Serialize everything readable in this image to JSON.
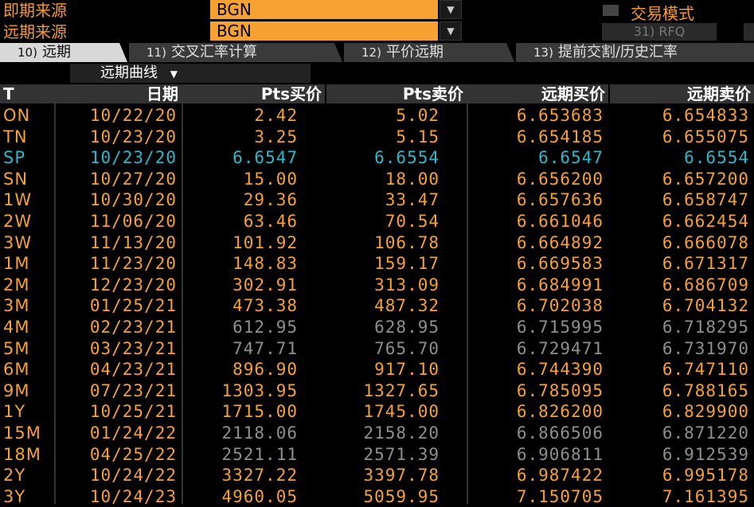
{
  "header": {
    "spot_source_label": "即期来源",
    "spot_source_value": "BGN",
    "fwd_source_label": "远期来源",
    "fwd_source_value": "BGN",
    "mode_label": "交易模式",
    "rfq_label": "31) RFQ"
  },
  "tabs": [
    {
      "num": "10)",
      "label": "远期"
    },
    {
      "num": "11)",
      "label": "交叉汇率计算"
    },
    {
      "num": "12)",
      "label": "平价远期"
    },
    {
      "num": "13)",
      "label": "提前交割/历史汇率"
    }
  ],
  "curve_select": "远期曲线",
  "columns": [
    "T",
    "日期",
    "Pts买价",
    "Pts卖价",
    "远期买价",
    "远期卖价"
  ],
  "colors": {
    "orange": "#f7a133",
    "cyan": "#2fb7c9",
    "gray": "#8f8f8f"
  },
  "rows": [
    {
      "t": "ON",
      "date": "10/22/20",
      "pb": "2.42",
      "ps": "5.02",
      "fb": "6.653683",
      "fs": "6.654833",
      "c": "orange"
    },
    {
      "t": "TN",
      "date": "10/23/20",
      "pb": "3.25",
      "ps": "5.15",
      "fb": "6.654185",
      "fs": "6.655075",
      "c": "orange"
    },
    {
      "t": "SP",
      "date": "10/23/20",
      "pb": "6.6547",
      "ps": "6.6554",
      "fb": "6.6547",
      "fs": "6.6554",
      "c": "cyan"
    },
    {
      "t": "SN",
      "date": "10/27/20",
      "pb": "15.00",
      "ps": "18.00",
      "fb": "6.656200",
      "fs": "6.657200",
      "c": "orange"
    },
    {
      "t": "1W",
      "date": "10/30/20",
      "pb": "29.36",
      "ps": "33.47",
      "fb": "6.657636",
      "fs": "6.658747",
      "c": "orange"
    },
    {
      "t": "2W",
      "date": "11/06/20",
      "pb": "63.46",
      "ps": "70.54",
      "fb": "6.661046",
      "fs": "6.662454",
      "c": "orange"
    },
    {
      "t": "3W",
      "date": "11/13/20",
      "pb": "101.92",
      "ps": "106.78",
      "fb": "6.664892",
      "fs": "6.666078",
      "c": "orange"
    },
    {
      "t": "1M",
      "date": "11/23/20",
      "pb": "148.83",
      "ps": "159.17",
      "fb": "6.669583",
      "fs": "6.671317",
      "c": "orange"
    },
    {
      "t": "2M",
      "date": "12/23/20",
      "pb": "302.91",
      "ps": "313.09",
      "fb": "6.684991",
      "fs": "6.686709",
      "c": "orange"
    },
    {
      "t": "3M",
      "date": "01/25/21",
      "pb": "473.38",
      "ps": "487.32",
      "fb": "6.702038",
      "fs": "6.704132",
      "c": "orange"
    },
    {
      "t": "4M",
      "date": "02/23/21",
      "pb": "612.95",
      "ps": "628.95",
      "fb": "6.715995",
      "fs": "6.718295",
      "c": "gray"
    },
    {
      "t": "5M",
      "date": "03/23/21",
      "pb": "747.71",
      "ps": "765.70",
      "fb": "6.729471",
      "fs": "6.731970",
      "c": "gray"
    },
    {
      "t": "6M",
      "date": "04/23/21",
      "pb": "896.90",
      "ps": "917.10",
      "fb": "6.744390",
      "fs": "6.747110",
      "c": "orange"
    },
    {
      "t": "9M",
      "date": "07/23/21",
      "pb": "1303.95",
      "ps": "1327.65",
      "fb": "6.785095",
      "fs": "6.788165",
      "c": "orange"
    },
    {
      "t": "1Y",
      "date": "10/25/21",
      "pb": "1715.00",
      "ps": "1745.00",
      "fb": "6.826200",
      "fs": "6.829900",
      "c": "orange"
    },
    {
      "t": "15M",
      "date": "01/24/22",
      "pb": "2118.06",
      "ps": "2158.20",
      "fb": "6.866506",
      "fs": "6.871220",
      "c": "gray"
    },
    {
      "t": "18M",
      "date": "04/25/22",
      "pb": "2521.11",
      "ps": "2571.39",
      "fb": "6.906811",
      "fs": "6.912539",
      "c": "gray"
    },
    {
      "t": "2Y",
      "date": "10/24/22",
      "pb": "3327.22",
      "ps": "3397.78",
      "fb": "6.987422",
      "fs": "6.995178",
      "c": "orange"
    },
    {
      "t": "3Y",
      "date": "10/24/23",
      "pb": "4960.05",
      "ps": "5059.95",
      "fb": "7.150705",
      "fs": "7.161395",
      "c": "orange"
    }
  ]
}
